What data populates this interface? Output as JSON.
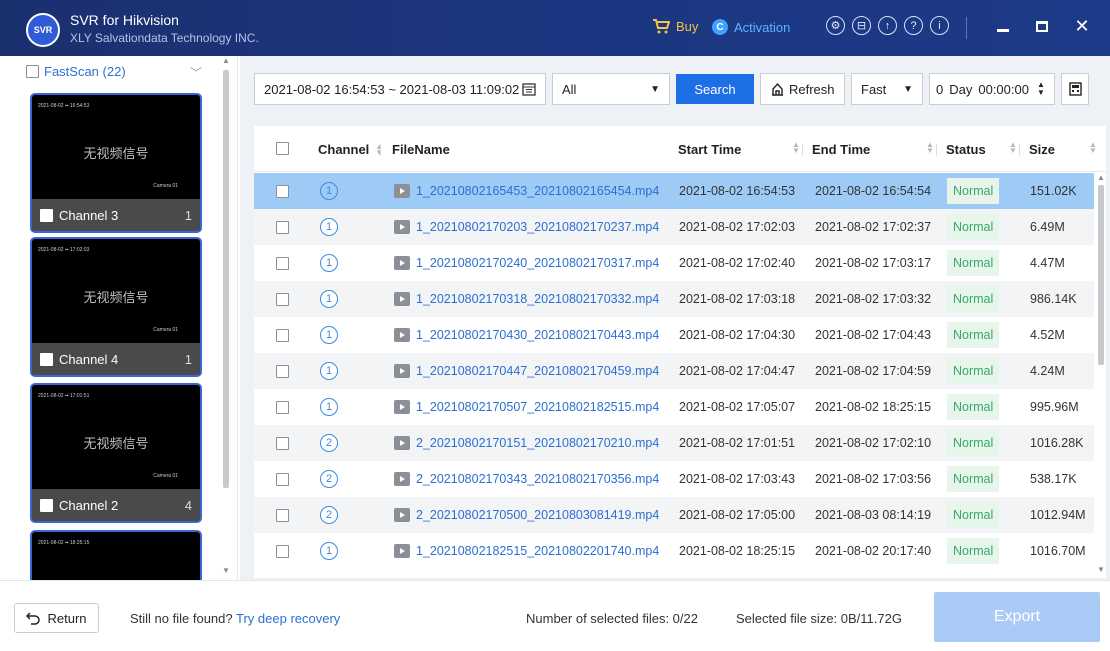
{
  "app": {
    "logo_text": "SVR",
    "title": "SVR for Hikvision",
    "subtitle": "XLY Salvationdata Technology INC."
  },
  "topbar": {
    "buy_label": "Buy",
    "activation_label": "Activation",
    "tools": [
      {
        "icon": "settings-icon",
        "glyph": "⚙"
      },
      {
        "icon": "save-icon",
        "glyph": "⊟"
      },
      {
        "icon": "upload-icon",
        "glyph": "↑"
      },
      {
        "icon": "help-icon",
        "glyph": "?"
      },
      {
        "icon": "info-icon",
        "glyph": "i"
      }
    ],
    "close_glyph": "✕"
  },
  "left": {
    "fastscan_label": "FastScan (22)",
    "thumb_overlay": "无视频信号",
    "channels": [
      {
        "label": "Channel 3",
        "count": "1"
      },
      {
        "label": "Channel 4",
        "count": "1"
      },
      {
        "label": "Channel 2",
        "count": "4"
      },
      {
        "label": "",
        "count": ""
      }
    ]
  },
  "filters": {
    "date_range": "2021-08-02 16:54:53 ~ 2021-08-03 11:09:02",
    "type_select": "All",
    "search_label": "Search",
    "refresh_label": "Refresh",
    "speed_select": "Fast",
    "day_value": "0",
    "day_label": "Day",
    "time_value": "00:00:00"
  },
  "table": {
    "columns": [
      "Channel",
      "FileName",
      "Start Time",
      "End Time",
      "Status",
      "Size"
    ],
    "rows": [
      {
        "channel": "1",
        "file": "1_20210802165453_20210802165454.mp4",
        "start": "2021-08-02 16:54:53",
        "end": "2021-08-02 16:54:54",
        "status": "Normal",
        "size": "151.02K",
        "selected": true
      },
      {
        "channel": "1",
        "file": "1_20210802170203_20210802170237.mp4",
        "start": "2021-08-02 17:02:03",
        "end": "2021-08-02 17:02:37",
        "status": "Normal",
        "size": "6.49M"
      },
      {
        "channel": "1",
        "file": "1_20210802170240_20210802170317.mp4",
        "start": "2021-08-02 17:02:40",
        "end": "2021-08-02 17:03:17",
        "status": "Normal",
        "size": "4.47M"
      },
      {
        "channel": "1",
        "file": "1_20210802170318_20210802170332.mp4",
        "start": "2021-08-02 17:03:18",
        "end": "2021-08-02 17:03:32",
        "status": "Normal",
        "size": "986.14K"
      },
      {
        "channel": "1",
        "file": "1_20210802170430_20210802170443.mp4",
        "start": "2021-08-02 17:04:30",
        "end": "2021-08-02 17:04:43",
        "status": "Normal",
        "size": "4.52M"
      },
      {
        "channel": "1",
        "file": "1_20210802170447_20210802170459.mp4",
        "start": "2021-08-02 17:04:47",
        "end": "2021-08-02 17:04:59",
        "status": "Normal",
        "size": "4.24M"
      },
      {
        "channel": "1",
        "file": "1_20210802170507_20210802182515.mp4",
        "start": "2021-08-02 17:05:07",
        "end": "2021-08-02 18:25:15",
        "status": "Normal",
        "size": "995.96M"
      },
      {
        "channel": "2",
        "file": "2_20210802170151_20210802170210.mp4",
        "start": "2021-08-02 17:01:51",
        "end": "2021-08-02 17:02:10",
        "status": "Normal",
        "size": "1016.28K"
      },
      {
        "channel": "2",
        "file": "2_20210802170343_20210802170356.mp4",
        "start": "2021-08-02 17:03:43",
        "end": "2021-08-02 17:03:56",
        "status": "Normal",
        "size": "538.17K"
      },
      {
        "channel": "2",
        "file": "2_20210802170500_20210803081419.mp4",
        "start": "2021-08-02 17:05:00",
        "end": "2021-08-03 08:14:19",
        "status": "Normal",
        "size": "1012.94M"
      },
      {
        "channel": "1",
        "file": "1_20210802182515_20210802201740.mp4",
        "start": "2021-08-02 18:25:15",
        "end": "2021-08-02 20:17:40",
        "status": "Normal",
        "size": "1016.70M"
      }
    ]
  },
  "bottom": {
    "return_label": "Return",
    "no_file_text": "Still no file found?",
    "deep_recovery_label": "Try deep recovery",
    "selected_count": "Number of selected files: 0/22",
    "selected_size": "Selected file size: 0B/11.72G",
    "export_label": "Export"
  }
}
